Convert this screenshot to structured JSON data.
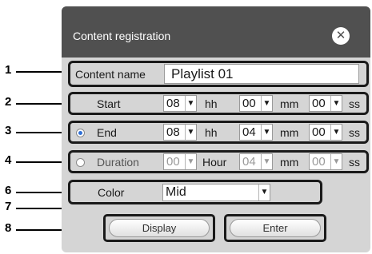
{
  "dialog": {
    "title": "Content registration",
    "close_icon": "close-x-icon"
  },
  "content_name": {
    "label": "Content name",
    "value": "Playlist 01"
  },
  "start": {
    "label": "Start",
    "hours": "08",
    "hours_unit": "hh",
    "minutes": "00",
    "minutes_unit": "mm",
    "seconds": "00",
    "seconds_unit": "ss",
    "dropdown_icon": "chevron-down-icon"
  },
  "end": {
    "label": "End",
    "selected": true,
    "hours": "08",
    "hours_unit": "hh",
    "minutes": "04",
    "minutes_unit": "mm",
    "seconds": "00",
    "seconds_unit": "ss"
  },
  "duration": {
    "label": "Duration",
    "selected": false,
    "hours": "00",
    "hours_unit": "Hour",
    "minutes": "04",
    "minutes_unit": "mm",
    "seconds": "00",
    "seconds_unit": "ss"
  },
  "color": {
    "label": "Color",
    "value": "Mid"
  },
  "buttons": {
    "display": "Display",
    "enter": "Enter"
  },
  "callouts": [
    "1",
    "2",
    "3",
    "4",
    "6",
    "7",
    "8"
  ],
  "colors": {
    "titlebar": "#505050",
    "dialog_body": "#d5d5d5",
    "radio_selected": "#2f6fd6"
  }
}
